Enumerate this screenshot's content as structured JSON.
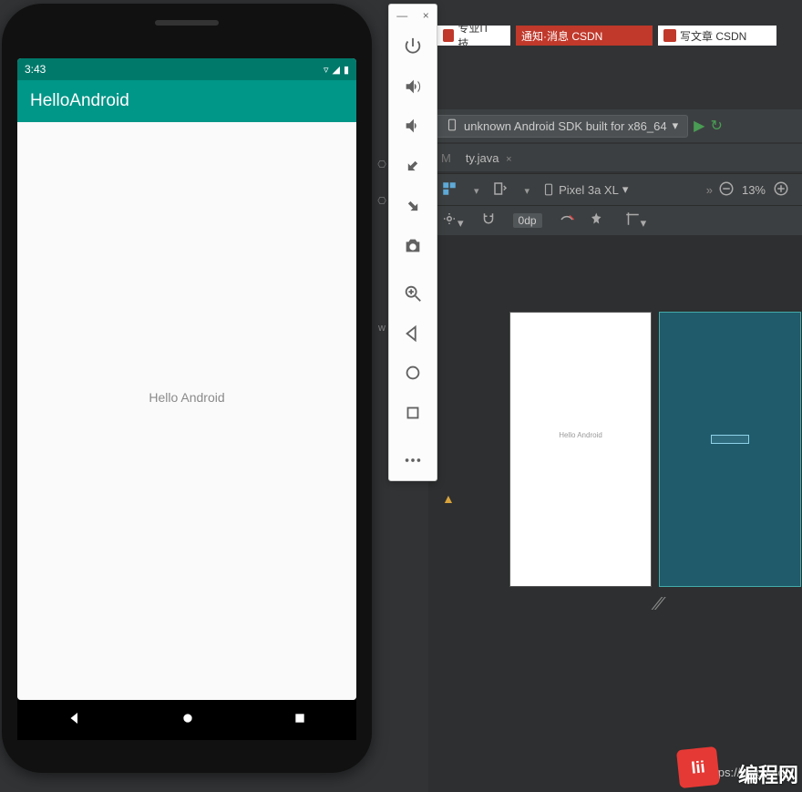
{
  "emulator": {
    "status_time": "3:43",
    "app_title": "HelloAndroid",
    "body_text": "Hello Android",
    "panel_icons": [
      "power",
      "vol-up",
      "vol-down",
      "rotate-left",
      "rotate-right",
      "camera",
      "zoom-in",
      "back",
      "home",
      "recent",
      "more"
    ]
  },
  "ide": {
    "device_dropdown": "unknown Android SDK built for x86_64",
    "editor_tab": "ty.java",
    "editor_tab_prefix": "M",
    "design_device": "Pixel 3a XL",
    "zoom_label": "13%",
    "dp_label": "0dp",
    "preview_text": "Hello Android"
  },
  "browser_tabs": {
    "t1": "专业IT技…",
    "t2": "通知·消息  CSDN",
    "t3": "写文章  CSDN"
  },
  "watermark": {
    "url": "https://blog.csdn",
    "logo_inner": "lii",
    "logo_text": "编程网"
  }
}
